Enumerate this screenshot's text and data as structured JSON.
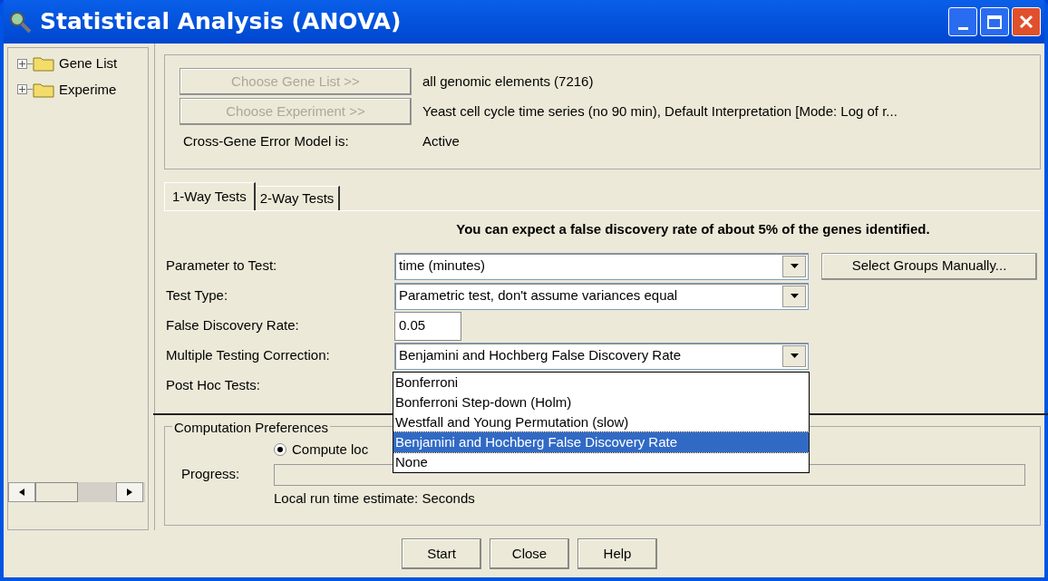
{
  "window": {
    "title": "Statistical Analysis (ANOVA)"
  },
  "tree": [
    {
      "label": "Gene List",
      "expanded": false
    },
    {
      "label": "Experime",
      "expanded": false
    }
  ],
  "selection": {
    "rows": [
      {
        "button": "Choose Gene List >>",
        "disabled": true,
        "value": "all genomic elements (7216)"
      },
      {
        "button": "Choose Experiment >>",
        "disabled": true,
        "value": "Yeast cell cycle time series (no 90 min), Default Interpretation [Mode: Log of r..."
      }
    ],
    "error_model_label": "Cross-Gene Error Model is:",
    "error_model_value": "Active"
  },
  "tabs": [
    {
      "label": "1-Way Tests",
      "selected": true
    },
    {
      "label": "2-Way Tests",
      "selected": false
    }
  ],
  "message": "You can expect a false discovery rate of about 5% of the genes identified.",
  "form": [
    {
      "kind": "dropdown",
      "label": "Parameter to Test:",
      "value": "time (minutes)"
    },
    {
      "kind": "dropdown",
      "label": "Test Type:",
      "value": "Parametric test, don't assume variances equal"
    },
    {
      "kind": "text",
      "label": "False Discovery Rate:",
      "value": "0.05"
    },
    {
      "kind": "dropdown",
      "label": "Multiple Testing Correction:",
      "value": "Benjamini and Hochberg False Discovery Rate"
    },
    {
      "kind": "label",
      "label": "Post Hoc Tests:"
    }
  ],
  "select_groups_button": "Select Groups Manually...",
  "popup": [
    {
      "label": "Bonferroni",
      "selected": false
    },
    {
      "label": "Bonferroni Step-down (Holm)",
      "selected": false
    },
    {
      "label": "Westfall and Young Permutation (slow)",
      "selected": false
    },
    {
      "label": "Benjamini and Hochberg False Discovery Rate",
      "selected": true
    },
    {
      "label": "None",
      "selected": false
    }
  ],
  "computation": {
    "title": "Computation Preferences",
    "radio": {
      "label": "Compute loc",
      "selected": true
    },
    "progress_label": "Progress:",
    "level": 0,
    "estimate": "Local run time estimate: Seconds"
  },
  "buttons": [
    "Start",
    "Close",
    "Help"
  ]
}
